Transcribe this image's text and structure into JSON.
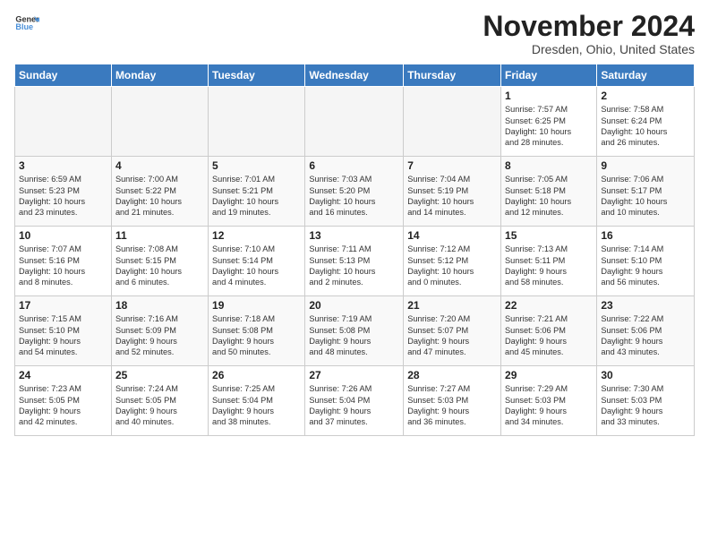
{
  "header": {
    "logo_general": "General",
    "logo_blue": "Blue",
    "month": "November 2024",
    "location": "Dresden, Ohio, United States"
  },
  "weekdays": [
    "Sunday",
    "Monday",
    "Tuesday",
    "Wednesday",
    "Thursday",
    "Friday",
    "Saturday"
  ],
  "weeks": [
    [
      {
        "day": "",
        "info": ""
      },
      {
        "day": "",
        "info": ""
      },
      {
        "day": "",
        "info": ""
      },
      {
        "day": "",
        "info": ""
      },
      {
        "day": "",
        "info": ""
      },
      {
        "day": "1",
        "info": "Sunrise: 7:57 AM\nSunset: 6:25 PM\nDaylight: 10 hours\nand 28 minutes."
      },
      {
        "day": "2",
        "info": "Sunrise: 7:58 AM\nSunset: 6:24 PM\nDaylight: 10 hours\nand 26 minutes."
      }
    ],
    [
      {
        "day": "3",
        "info": "Sunrise: 6:59 AM\nSunset: 5:23 PM\nDaylight: 10 hours\nand 23 minutes."
      },
      {
        "day": "4",
        "info": "Sunrise: 7:00 AM\nSunset: 5:22 PM\nDaylight: 10 hours\nand 21 minutes."
      },
      {
        "day": "5",
        "info": "Sunrise: 7:01 AM\nSunset: 5:21 PM\nDaylight: 10 hours\nand 19 minutes."
      },
      {
        "day": "6",
        "info": "Sunrise: 7:03 AM\nSunset: 5:20 PM\nDaylight: 10 hours\nand 16 minutes."
      },
      {
        "day": "7",
        "info": "Sunrise: 7:04 AM\nSunset: 5:19 PM\nDaylight: 10 hours\nand 14 minutes."
      },
      {
        "day": "8",
        "info": "Sunrise: 7:05 AM\nSunset: 5:18 PM\nDaylight: 10 hours\nand 12 minutes."
      },
      {
        "day": "9",
        "info": "Sunrise: 7:06 AM\nSunset: 5:17 PM\nDaylight: 10 hours\nand 10 minutes."
      }
    ],
    [
      {
        "day": "10",
        "info": "Sunrise: 7:07 AM\nSunset: 5:16 PM\nDaylight: 10 hours\nand 8 minutes."
      },
      {
        "day": "11",
        "info": "Sunrise: 7:08 AM\nSunset: 5:15 PM\nDaylight: 10 hours\nand 6 minutes."
      },
      {
        "day": "12",
        "info": "Sunrise: 7:10 AM\nSunset: 5:14 PM\nDaylight: 10 hours\nand 4 minutes."
      },
      {
        "day": "13",
        "info": "Sunrise: 7:11 AM\nSunset: 5:13 PM\nDaylight: 10 hours\nand 2 minutes."
      },
      {
        "day": "14",
        "info": "Sunrise: 7:12 AM\nSunset: 5:12 PM\nDaylight: 10 hours\nand 0 minutes."
      },
      {
        "day": "15",
        "info": "Sunrise: 7:13 AM\nSunset: 5:11 PM\nDaylight: 9 hours\nand 58 minutes."
      },
      {
        "day": "16",
        "info": "Sunrise: 7:14 AM\nSunset: 5:10 PM\nDaylight: 9 hours\nand 56 minutes."
      }
    ],
    [
      {
        "day": "17",
        "info": "Sunrise: 7:15 AM\nSunset: 5:10 PM\nDaylight: 9 hours\nand 54 minutes."
      },
      {
        "day": "18",
        "info": "Sunrise: 7:16 AM\nSunset: 5:09 PM\nDaylight: 9 hours\nand 52 minutes."
      },
      {
        "day": "19",
        "info": "Sunrise: 7:18 AM\nSunset: 5:08 PM\nDaylight: 9 hours\nand 50 minutes."
      },
      {
        "day": "20",
        "info": "Sunrise: 7:19 AM\nSunset: 5:08 PM\nDaylight: 9 hours\nand 48 minutes."
      },
      {
        "day": "21",
        "info": "Sunrise: 7:20 AM\nSunset: 5:07 PM\nDaylight: 9 hours\nand 47 minutes."
      },
      {
        "day": "22",
        "info": "Sunrise: 7:21 AM\nSunset: 5:06 PM\nDaylight: 9 hours\nand 45 minutes."
      },
      {
        "day": "23",
        "info": "Sunrise: 7:22 AM\nSunset: 5:06 PM\nDaylight: 9 hours\nand 43 minutes."
      }
    ],
    [
      {
        "day": "24",
        "info": "Sunrise: 7:23 AM\nSunset: 5:05 PM\nDaylight: 9 hours\nand 42 minutes."
      },
      {
        "day": "25",
        "info": "Sunrise: 7:24 AM\nSunset: 5:05 PM\nDaylight: 9 hours\nand 40 minutes."
      },
      {
        "day": "26",
        "info": "Sunrise: 7:25 AM\nSunset: 5:04 PM\nDaylight: 9 hours\nand 38 minutes."
      },
      {
        "day": "27",
        "info": "Sunrise: 7:26 AM\nSunset: 5:04 PM\nDaylight: 9 hours\nand 37 minutes."
      },
      {
        "day": "28",
        "info": "Sunrise: 7:27 AM\nSunset: 5:03 PM\nDaylight: 9 hours\nand 36 minutes."
      },
      {
        "day": "29",
        "info": "Sunrise: 7:29 AM\nSunset: 5:03 PM\nDaylight: 9 hours\nand 34 minutes."
      },
      {
        "day": "30",
        "info": "Sunrise: 7:30 AM\nSunset: 5:03 PM\nDaylight: 9 hours\nand 33 minutes."
      }
    ]
  ]
}
